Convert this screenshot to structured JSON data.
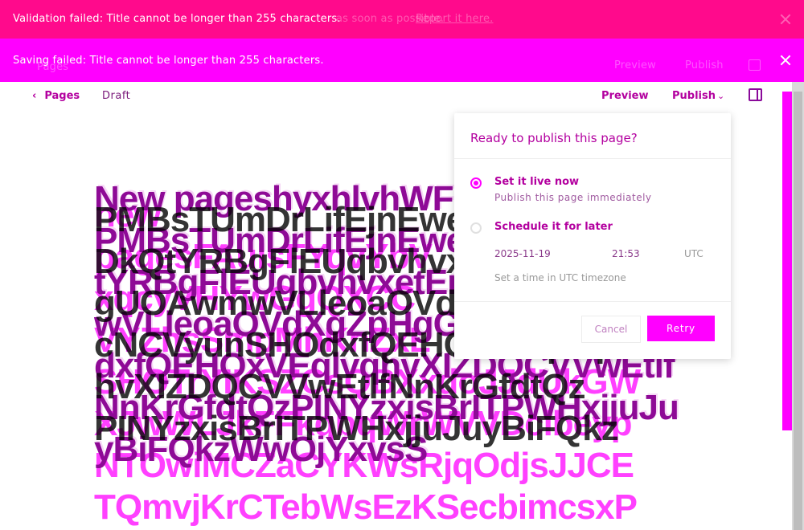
{
  "banners": {
    "validation_message": "Validation failed: Title cannot be longer than 255 characters.",
    "saving_message": "Saving failed: Title cannot be longer than 255 characters.",
    "ghost_text": "as soon as possible.",
    "ghost_link": "Report it here.",
    "ghost_pages": "Pages",
    "ghost_preview": "Preview",
    "ghost_publish": "Publish"
  },
  "header": {
    "back_label": "Pages",
    "status": "Draft",
    "preview_label": "Preview",
    "publish_label": "Publish"
  },
  "page": {
    "title": "New pageshyxhlvhWFQuOpjNogotiiJPMBsTUmDrLifEjnEweGoSmmoDkQtYRBgFlEUqbvhvxetEmlcmgUOAwmwVLleoaOVdXgZpHgGcNCVyunSHOdxfQEHOxVEqlvqhvXIZDQCVVwEtlfNnKrGfdtQzPINYzxisBrITPWHxjjuJuyBiFQkzWwOjYxvsS",
    "overlay_dark": "PMBsTUmDrLifEjnEweGoSmmo\nDkQtYRBgFlEUqbvhvxetEmlcm\ngUOAwmwVLleoaOVdXgZpHgG\ncNCVyunSHOdxfQEHOxVEqlvq\nhvXIZDQCVVwEtlfNnKrGfdtQz\nPINYzxisBrITPWHxjjuJuyBiFQkz",
    "overlay_pink": "new\npagesFAulsFYqvYbV\nxqcyVHYwGgQXCC\nVYZhsSmpMhKnZxL\nSHOTrYIKSZCsQBXxdoJJdUkGW\nXJwWLJkFFkqbqWrWVVDcibeyp\nNTOwiMCZaCYKWsRjqOdjsJJCE\nTQmvjKrCTebWsEzKSecbimcsxP"
  },
  "publish_popover": {
    "title": "Ready to publish this page?",
    "options": [
      {
        "label": "Set it live now",
        "description": "Publish this page immediately",
        "selected": true
      },
      {
        "label": "Schedule it for later",
        "description": "",
        "selected": false
      }
    ],
    "schedule": {
      "date": "2025-11-19",
      "time": "21:53",
      "timezone": "UTC",
      "note": "Set a time in UTC timezone"
    },
    "cancel_label": "Cancel",
    "retry_label": "Retry"
  },
  "colors": {
    "banner_validation": "#ff0a8c",
    "banner_saving": "#ff00ff",
    "accent": "#b3009f",
    "title": "#8e0a96",
    "retry": "#ff00ff"
  },
  "icons": [
    "close-icon",
    "chevron-left-icon",
    "chevron-down-icon",
    "sidebar-toggle-icon"
  ]
}
